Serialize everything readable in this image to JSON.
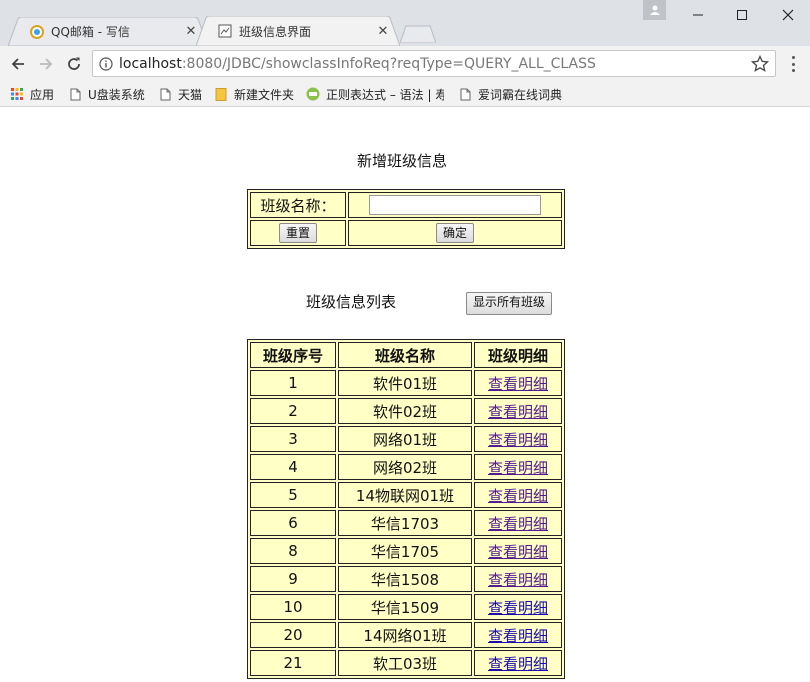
{
  "browser": {
    "tabs": [
      {
        "title": "QQ邮箱 - 写信",
        "active": false,
        "icon": "qq-mail-icon"
      },
      {
        "title": "班级信息界面",
        "active": true,
        "icon": "page-icon"
      }
    ],
    "url_host": "localhost",
    "url_rest": ":8080/JDBC/showclassInfoReq?reqType=QUERY_ALL_CLASS",
    "bookmarks": [
      {
        "label": "应用",
        "icon": "apps-grid-icon"
      },
      {
        "label": "U盘装系统",
        "icon": "page-icon"
      },
      {
        "label": "天猫",
        "icon": "page-icon"
      },
      {
        "label": "新建文件夹",
        "icon": "folder-icon"
      },
      {
        "label": "正则表达式 – 语法 | 寿",
        "icon": "regex-site-icon"
      },
      {
        "label": "爱词霸在线词典",
        "icon": "page-icon"
      }
    ]
  },
  "add_form": {
    "heading": "新增班级信息",
    "name_label": "班级名称：",
    "name_value": "",
    "reset_label": "重置",
    "submit_label": "确定"
  },
  "list": {
    "heading": "班级信息列表",
    "show_all_label": "显示所有班级",
    "columns": [
      "班级序号",
      "班级名称",
      "班级明细"
    ],
    "rows": [
      {
        "id": "1",
        "name": "软件01班",
        "link": "查看明细",
        "visited": true
      },
      {
        "id": "2",
        "name": "软件02班",
        "link": "查看明细",
        "visited": true
      },
      {
        "id": "3",
        "name": "网络01班",
        "link": "查看明细",
        "visited": true
      },
      {
        "id": "4",
        "name": "网络02班",
        "link": "查看明细",
        "visited": true
      },
      {
        "id": "5",
        "name": "14物联网01班",
        "link": "查看明细",
        "visited": true
      },
      {
        "id": "6",
        "name": "华信1703",
        "link": "查看明细",
        "visited": true
      },
      {
        "id": "8",
        "name": "华信1705",
        "link": "查看明细",
        "visited": true
      },
      {
        "id": "9",
        "name": "华信1508",
        "link": "查看明细",
        "visited": true
      },
      {
        "id": "10",
        "name": "华信1509",
        "link": "查看明细",
        "visited": false
      },
      {
        "id": "20",
        "name": "14网络01班",
        "link": "查看明细",
        "visited": false
      },
      {
        "id": "21",
        "name": "软工03班",
        "link": "查看明细",
        "visited": false
      }
    ]
  },
  "colors": {
    "table_bg": "#ffffc6",
    "visited_link": "#551a8b",
    "link": "#1a0dab",
    "titlebar": "#dee1e6",
    "toolbar": "#f2f2f2"
  }
}
